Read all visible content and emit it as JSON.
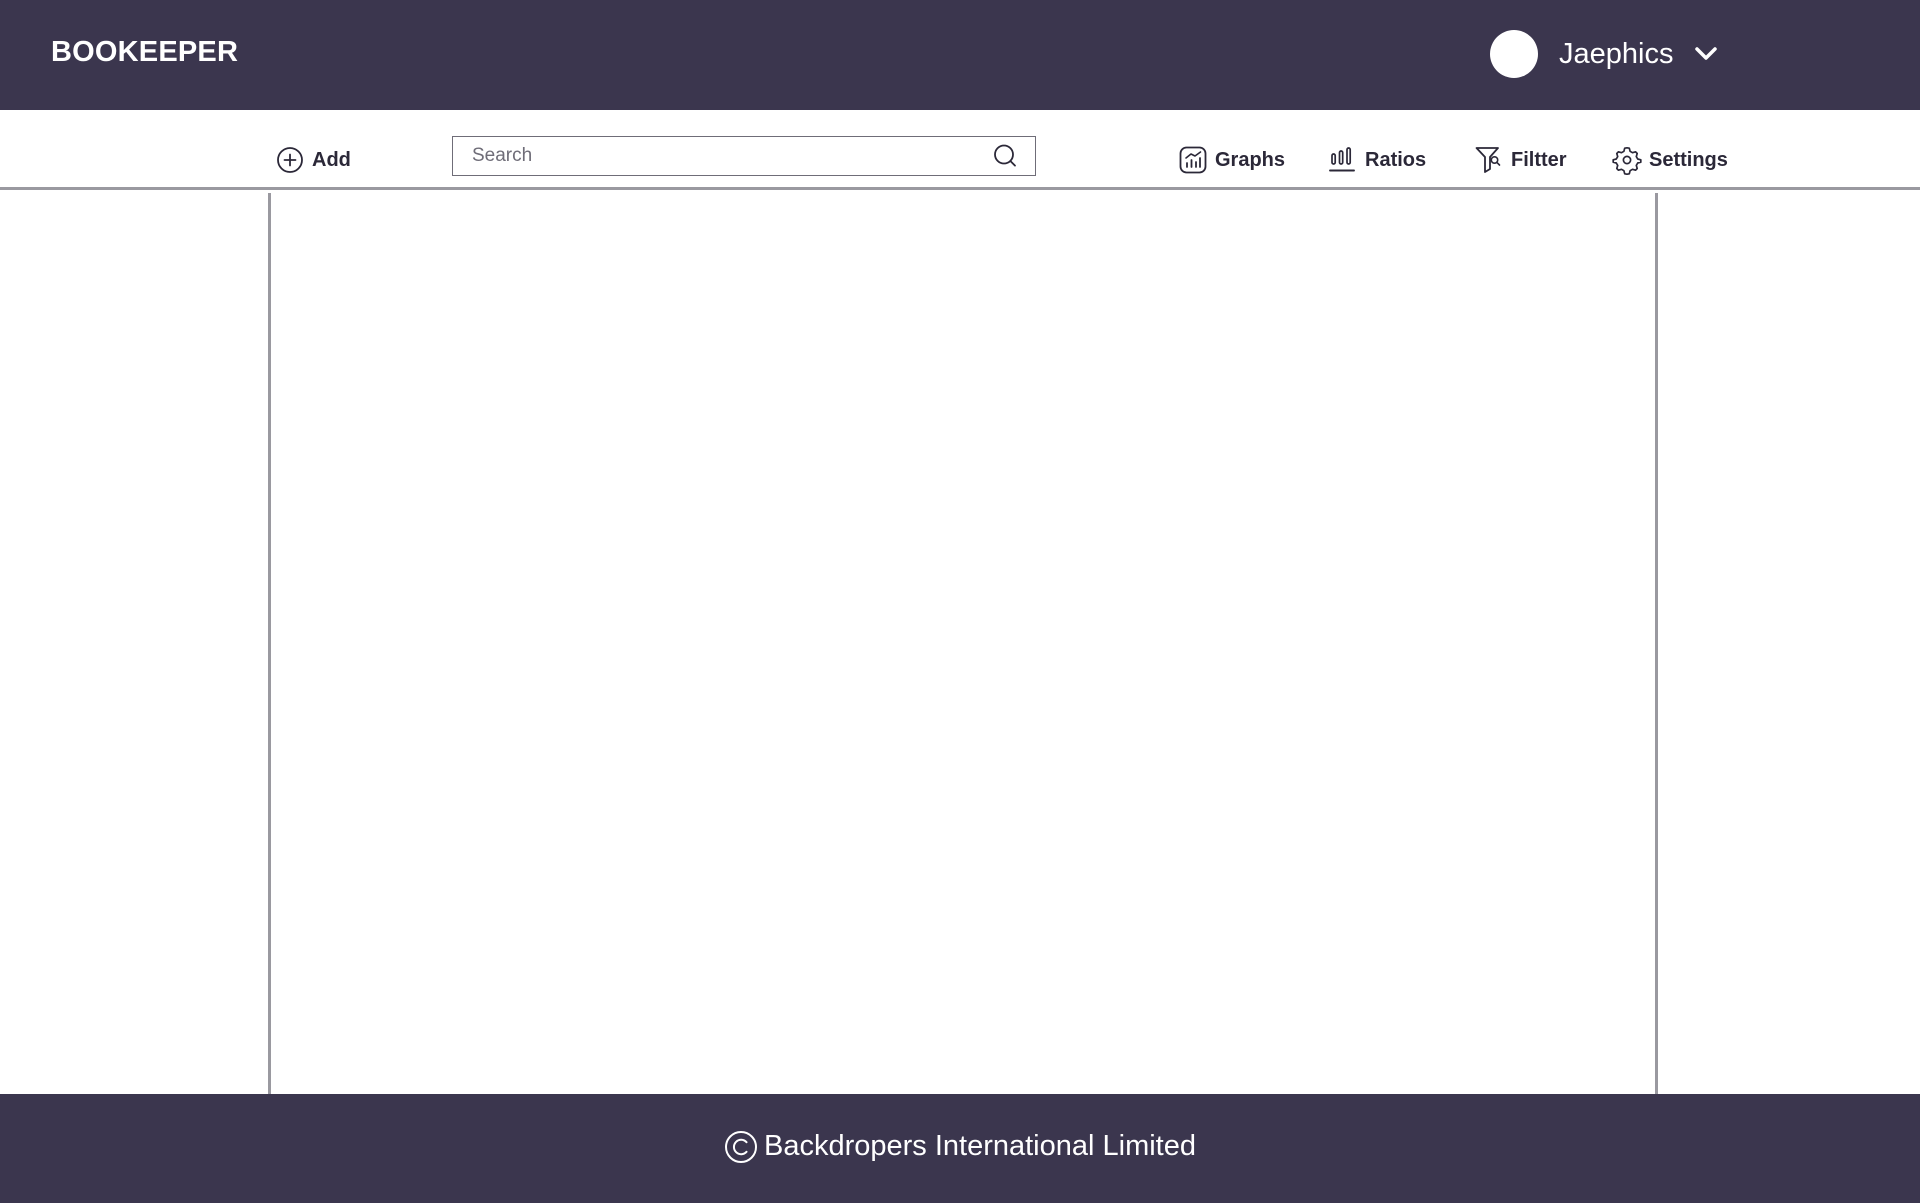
{
  "header": {
    "brand": "BOOKEEPER",
    "user": {
      "name": "Jaephics",
      "avatar_icon": "user-avatar",
      "dropdown_icon": "chevron-down-icon"
    }
  },
  "toolbar": {
    "add": {
      "label": "Add",
      "icon": "plus-circle-icon"
    },
    "search": {
      "placeholder": "Search",
      "value": "",
      "icon": "search-icon"
    },
    "graphs": {
      "label": "Graphs",
      "icon": "chart-icon"
    },
    "ratios": {
      "label": "Ratios",
      "icon": "bar-chart-icon"
    },
    "filter": {
      "label": "Filtter",
      "icon": "filter-icon"
    },
    "settings": {
      "label": "Settings",
      "icon": "gear-icon"
    }
  },
  "footer": {
    "copyright_icon": "copyright-icon",
    "text": "Backdropers International Limited"
  },
  "colors": {
    "header_bg": "#3b364e",
    "footer_bg": "#3b364e",
    "divider": "#9a99a0",
    "text_dark": "#2b2838"
  }
}
